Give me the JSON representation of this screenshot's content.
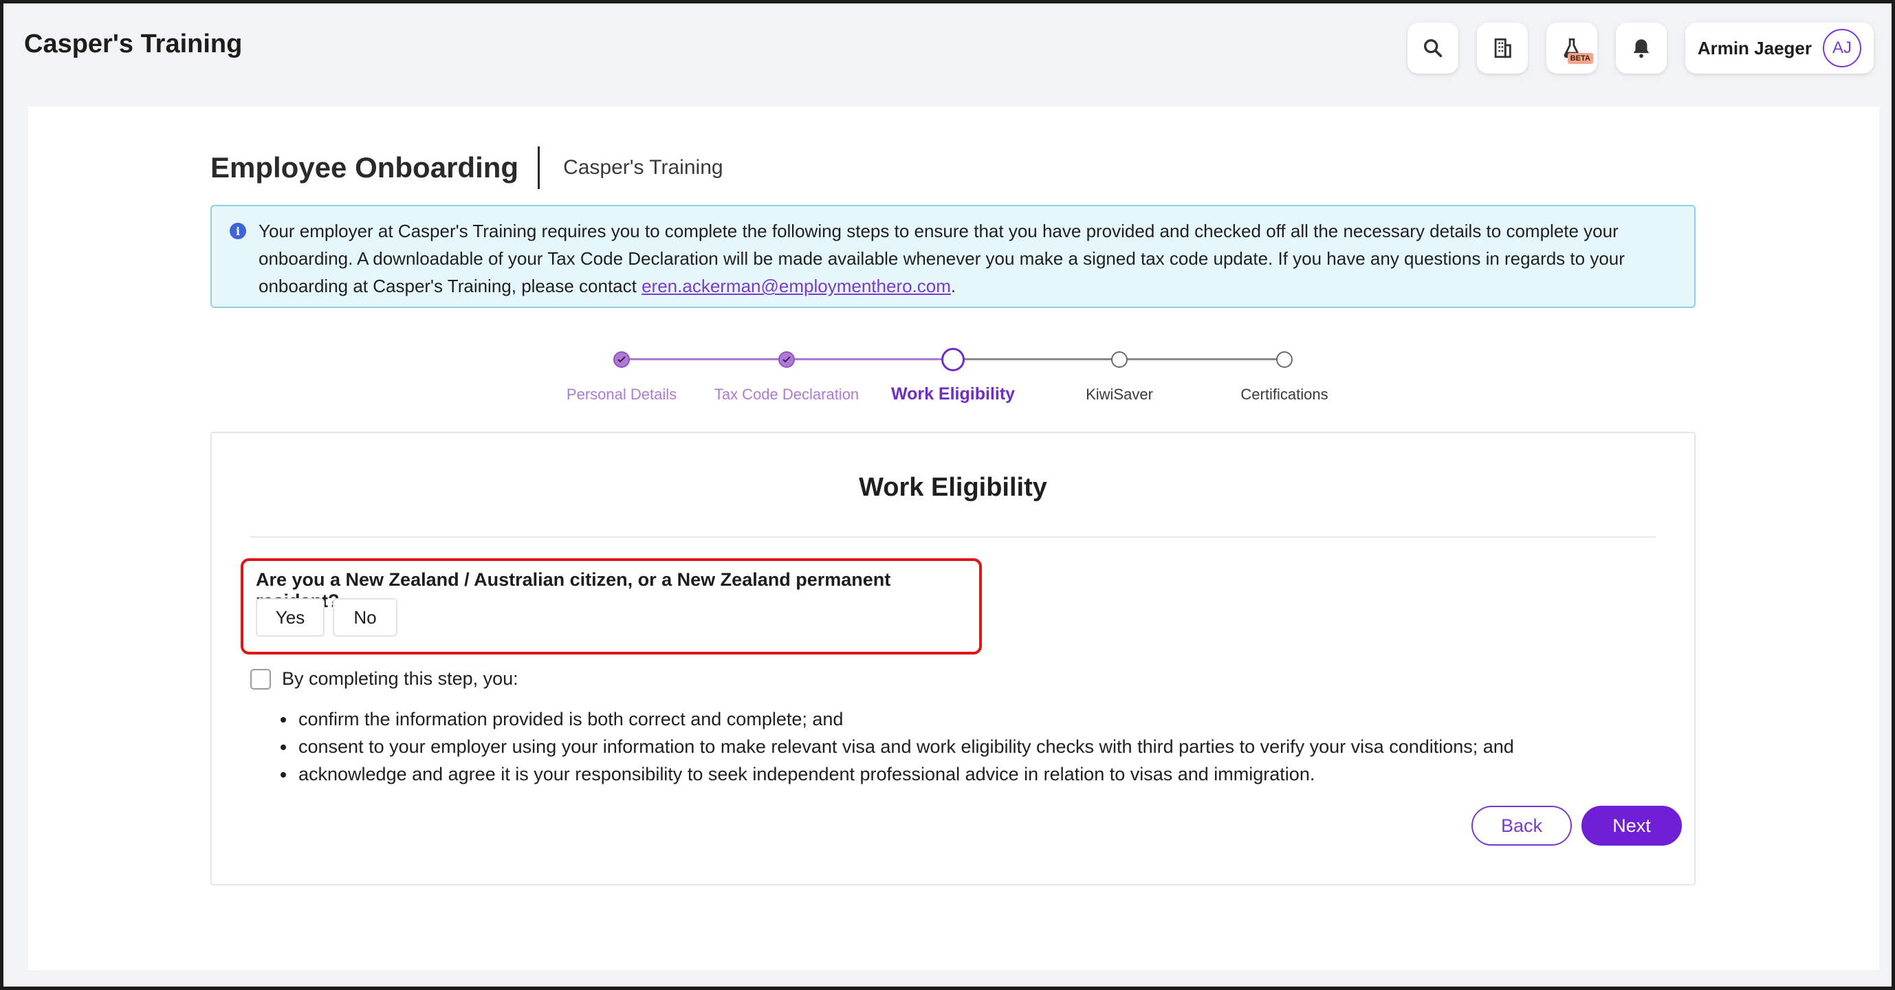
{
  "app": {
    "title": "Casper's Training"
  },
  "topbar": {
    "icons": [
      "search-icon",
      "building-icon",
      "beaker-icon",
      "bell-icon"
    ],
    "beta_label": "BETA",
    "user_name": "Armin Jaeger",
    "user_initials": "AJ"
  },
  "page": {
    "title": "Employee Onboarding",
    "subtitle": "Casper's Training"
  },
  "info": {
    "text_before": "Your employer at Casper's Training requires you to complete the following steps to ensure that you have provided and checked off all the necessary details to complete your onboarding. A downloadable of your Tax Code Declaration will be made available whenever you make a signed tax code update. If you have any questions in regards to your onboarding at Casper's Training, please contact ",
    "email": "eren.ackerman@employmenthero.com",
    "text_after": "."
  },
  "stepper": {
    "steps": [
      {
        "label": "Personal Details",
        "state": "done"
      },
      {
        "label": "Tax Code Declaration",
        "state": "done"
      },
      {
        "label": "Work Eligibility",
        "state": "current"
      },
      {
        "label": "KiwiSaver",
        "state": "todo"
      },
      {
        "label": "Certifications",
        "state": "todo"
      }
    ]
  },
  "form": {
    "title": "Work Eligibility",
    "question": "Are you a New Zealand / Australian citizen, or a New Zealand permanent resident?",
    "yes_label": "Yes",
    "no_label": "No",
    "confirm_label": "By completing this step, you:",
    "bullets": [
      "confirm the information provided is both correct and complete; and",
      "consent to your employer using your information to make relevant visa and work eligibility checks with third parties to verify your visa conditions; and",
      "acknowledge and agree it is your responsibility to seek independent professional advice in relation to visas and immigration."
    ],
    "back_label": "Back",
    "next_label": "Next"
  },
  "colors": {
    "accent": "#6f1fd6",
    "done_step": "#b07ad4",
    "highlight": "#e01616",
    "info_bg": "#e6f7fb"
  }
}
